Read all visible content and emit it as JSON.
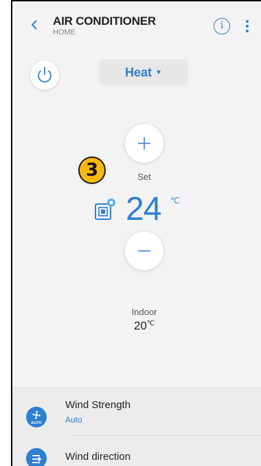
{
  "header": {
    "title": "AIR CONDITIONER",
    "subtitle": "HOME",
    "info_icon": "info-icon",
    "more_icon": "more-vertical-icon"
  },
  "mode": {
    "label": "Heat"
  },
  "badge": {
    "number": "3"
  },
  "temperature": {
    "set_label": "Set",
    "value": "24",
    "unit": "℃"
  },
  "indoor": {
    "label": "Indoor",
    "value": "20",
    "unit": "℃"
  },
  "settings": [
    {
      "title": "Wind Strength",
      "value": "Auto",
      "icon": "fan-auto-icon",
      "icon_text": "AUTO"
    },
    {
      "title": "Wind direction",
      "value": "",
      "icon": "wind-direction-icon"
    }
  ],
  "colors": {
    "accent": "#2f7fd0",
    "badge": "#f7b90f",
    "background": "#f3f3f3"
  }
}
